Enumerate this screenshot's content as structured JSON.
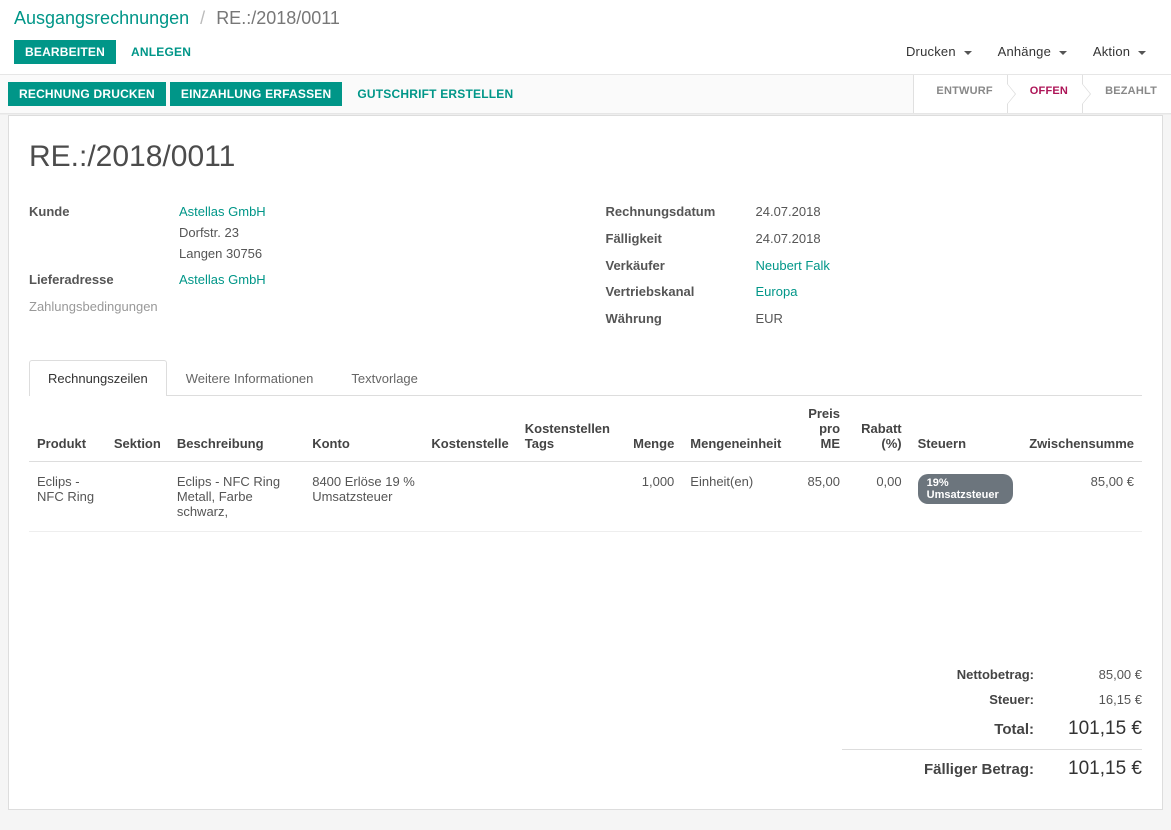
{
  "breadcrumb": {
    "root": "Ausgangsrechnungen",
    "current": "RE.:/2018/0011"
  },
  "toolbar": {
    "edit_label": "BEARBEITEN",
    "create_label": "ANLEGEN",
    "print_label": "Drucken",
    "attachments_label": "Anhänge",
    "action_label": "Aktion"
  },
  "actions": {
    "print_invoice": "RECHNUNG DRUCKEN",
    "register_payment": "EINZAHLUNG ERFASSEN",
    "create_credit": "GUTSCHRIFT ERSTELLEN"
  },
  "status": {
    "draft": "ENTWURF",
    "open": "OFFEN",
    "paid": "BEZAHLT"
  },
  "title": "RE.:/2018/0011",
  "left_fields": {
    "customer_label": "Kunde",
    "customer_name": "Astellas GmbH",
    "customer_street": "Dorfstr. 23",
    "customer_city": "Langen 30756",
    "delivery_label": "Lieferadresse",
    "delivery_name": "Astellas GmbH",
    "payment_terms_label": "Zahlungsbedingungen"
  },
  "right_fields": {
    "date_label": "Rechnungsdatum",
    "date_value": "24.07.2018",
    "due_label": "Fälligkeit",
    "due_value": "24.07.2018",
    "salesperson_label": "Verkäufer",
    "salesperson_value": "Neubert Falk",
    "channel_label": "Vertriebskanal",
    "channel_value": "Europa",
    "currency_label": "Währung",
    "currency_value": "EUR"
  },
  "tabs": {
    "lines": "Rechnungszeilen",
    "info": "Weitere Informationen",
    "text": "Textvorlage"
  },
  "columns": {
    "product": "Produkt",
    "section": "Sektion",
    "description": "Beschreibung",
    "account": "Konto",
    "costcenter": "Kostenstelle",
    "costcenter_tags": "Kostenstellen Tags",
    "quantity": "Menge",
    "uom": "Mengeneinheit",
    "unit_price": "Preis pro ME",
    "discount": "Rabatt (%)",
    "taxes": "Steuern",
    "subtotal": "Zwischensumme"
  },
  "rows": [
    {
      "product": "Eclips - NFC Ring",
      "section": "",
      "description": "Eclips - NFC Ring Metall, Farbe schwarz,",
      "account": "8400 Erlöse 19 % Umsatzsteuer",
      "costcenter": "",
      "costcenter_tags": "",
      "quantity": "1,000",
      "uom": "Einheit(en)",
      "unit_price": "85,00",
      "discount": "0,00",
      "tax": "19% Umsatzsteuer",
      "subtotal": "85,00 €"
    }
  ],
  "totals": {
    "net_label": "Nettobetrag:",
    "net_value": "85,00 €",
    "tax_label": "Steuer:",
    "tax_value": "16,15 €",
    "total_label": "Total:",
    "total_value": "101,15 €",
    "due_label": "Fälliger Betrag:",
    "due_value": "101,15 €"
  }
}
